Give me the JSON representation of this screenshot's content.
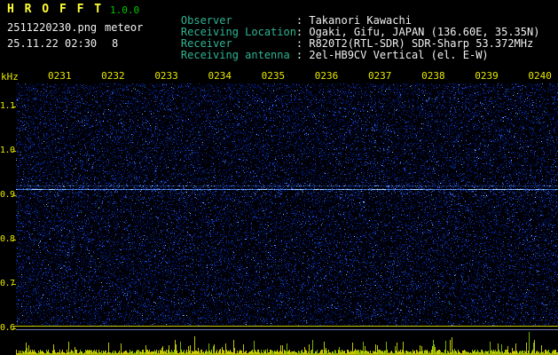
{
  "header": {
    "title": "H R O F F T",
    "version": "1.0.0",
    "file_name": "2511220230.png",
    "mode": "meteor",
    "timestamp": "25.11.22 02:30",
    "echo_count": "8"
  },
  "info": [
    {
      "label": "Observer",
      "value": ": Takanori Kawachi"
    },
    {
      "label": "Receiving Location",
      "value": ": Ogaki, Gifu, JAPAN (136.60E, 35.35N)"
    },
    {
      "label": "Receiver",
      "value": ": R820T2(RTL-SDR) SDR-Sharp 53.372MHz"
    },
    {
      "label": "Receiving antenna",
      "value": ": 2el-HB9CV Vertical (el. E-W)"
    }
  ],
  "axes": {
    "y_unit": "kHz",
    "y_ticks": [
      "1.1",
      "1.0",
      "0.9",
      "0.8",
      "0.7",
      "0.6"
    ],
    "x_ticks": [
      "0231",
      "0232",
      "0233",
      "0234",
      "0235",
      "0236",
      "0237",
      "0238",
      "0239",
      "0240"
    ]
  },
  "chart_data": {
    "type": "heatmap",
    "x_ticks": [
      "0231",
      "0232",
      "0233",
      "0234",
      "0235",
      "0236",
      "0237",
      "0238",
      "0239",
      "0240"
    ],
    "y_ticks": [
      1.1,
      1.0,
      0.9,
      0.8,
      0.7,
      0.6
    ],
    "y_unit": "kHz",
    "y_range_khz": [
      0.6,
      1.152
    ],
    "carrier_lines_khz": [
      0.915,
      0.922
    ],
    "echo_count": 8,
    "description": "10-minute radio meteor spectrogram: dense blue noise speckle on black, a continuous bright blue direct-carrier line near 0.92 kHz, a yellow separator line at 0.6 kHz, and a yellow/green noise-level trace strip along the bottom."
  },
  "render": {
    "seed": 20251122,
    "colors": {
      "background": "#000000",
      "axis_yellow": "#e8e800",
      "title_yellow": "#ffff33",
      "version_green": "#00c800",
      "label_teal": "#2fb491",
      "text_white": "#f0f0f0",
      "separator_yellow": "#c8c800",
      "average_line_blue": "#8090c8",
      "trace_yellow": "#c6c600",
      "trace_green": "#7ab400"
    },
    "noise": {
      "dark": 30000,
      "mid": 9000,
      "bright": 1700,
      "spark": 260,
      "green": 50
    }
  }
}
